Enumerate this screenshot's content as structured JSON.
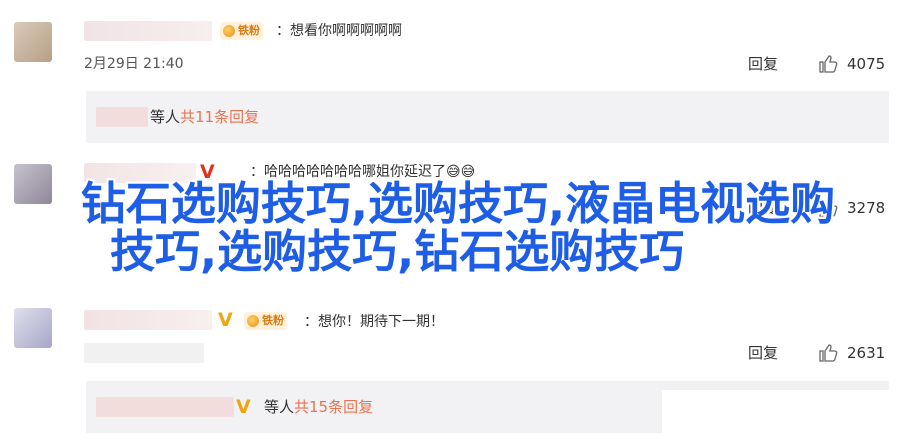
{
  "comments": [
    {
      "text": "：想看你啊啊啊啊啊",
      "fan_badge": "铁粉",
      "time": "2月29日 21:40",
      "reply_label": "回复",
      "likes": "4075",
      "sub": {
        "prefix": "等人",
        "link": "共11条回复"
      }
    },
    {
      "text": "：哈哈哈哈哈哈哈哪姐你延迟了",
      "verified": "V",
      "emoji": "😅😅",
      "reply_label": "回复",
      "likes": "3278"
    },
    {
      "text": "：想你！期待下一期！",
      "verified": "V",
      "fan_badge": "铁粉",
      "reply_label": "回复",
      "likes": "2631",
      "sub": {
        "verified": "V",
        "prefix": "等人",
        "link": "共15条回复"
      }
    }
  ],
  "overlay": {
    "line1": "钻石选购技巧,选购技巧,液晶电视选购",
    "line2": "技巧,选购技巧,钻石选购技巧"
  },
  "colors": {
    "overlay_text": "#1e5ee6",
    "link": "#eb7350",
    "fan_badge": "#e07a10"
  }
}
